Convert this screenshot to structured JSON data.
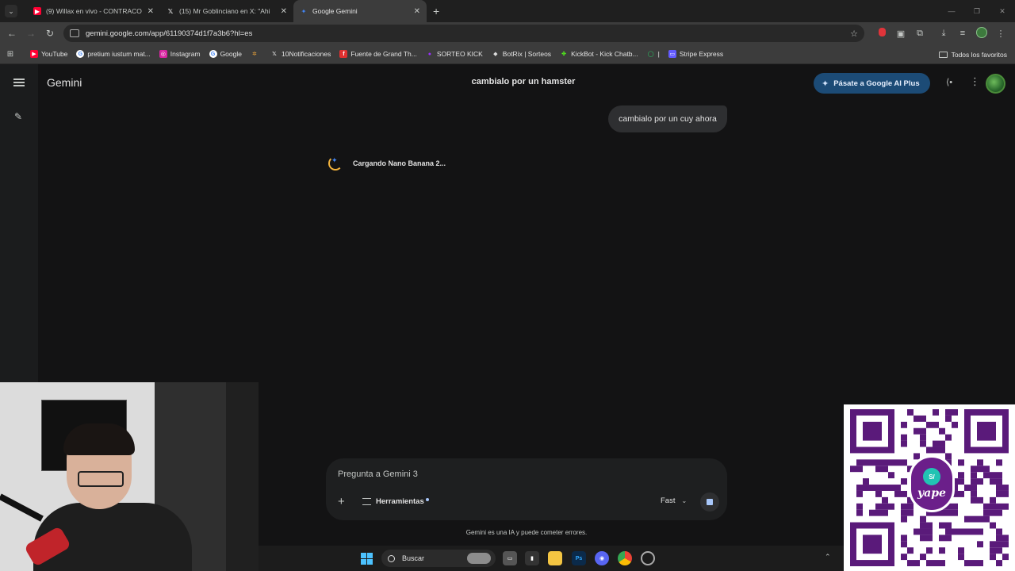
{
  "browser": {
    "tabs": [
      {
        "title": "(9) Willax en vivo - CONTRACO",
        "favicon": "youtube-icon",
        "color": "#ff0033",
        "active": false
      },
      {
        "title": "(15) Mr Goblinciano en X: \"Ahi",
        "favicon": "x-icon",
        "color": "#000000",
        "active": false
      },
      {
        "title": "Google Gemini",
        "favicon": "gemini-icon",
        "color": "#4285f4",
        "active": true
      }
    ],
    "url": "gemini.google.com/app/61190374d1f7a3b6?hl=es",
    "bookmarks": [
      {
        "label": "YouTube",
        "icon": "youtube-icon",
        "color": "#ff0033"
      },
      {
        "label": "pretium iustum mat...",
        "icon": "google-icon",
        "color": "#ffffff"
      },
      {
        "label": "Instagram",
        "icon": "instagram-icon",
        "color": "#d6249f"
      },
      {
        "label": "Google",
        "icon": "google-icon",
        "color": "#ffffff"
      },
      {
        "label": "",
        "icon": "pinwheel-icon",
        "color": "#e8a23b"
      },
      {
        "label": "10Notificaciones",
        "icon": "x-icon",
        "color": "#000000"
      },
      {
        "label": "Fuente de Grand Th...",
        "icon": "font-icon",
        "color": "#e03030"
      },
      {
        "label": "SORTEO KICK",
        "icon": "purple-dot-icon",
        "color": "#9b30ff"
      },
      {
        "label": "BotRix | Sorteos",
        "icon": "diamond-icon",
        "color": "#dddddd"
      },
      {
        "label": "KickBot - Kick Chatb...",
        "icon": "kickbot-icon",
        "color": "#53fc18"
      },
      {
        "label": "|",
        "icon": "whatsapp-icon",
        "color": "#25d366"
      },
      {
        "label": "Stripe Express",
        "icon": "stripe-icon",
        "color": "#635bff"
      }
    ],
    "all_bookmarks_label": "Todos los favoritos"
  },
  "gemini": {
    "brand": "Gemini",
    "conversation_title": "cambialo por un hamster",
    "upgrade_label": "Pásate a Google AI Plus",
    "user_message": "cambialo por un cuy ahora",
    "loading_text": "Cargando Nano Banana 2...",
    "input_placeholder": "Pregunta a Gemini 3",
    "tools_label": "Herramientas",
    "model_label": "Fast",
    "disclaimer": "Gemini es una IA y puede cometer errores.",
    "accent": "#1c4b76"
  },
  "overlays": {
    "qr_brand": "yape",
    "qr_symbol": "S/"
  },
  "taskbar": {
    "search_label": "Buscar",
    "apps": [
      "file-explorer-icon",
      "taskview-icon",
      "files-icon",
      "photoshop-icon",
      "discord-icon",
      "chrome-icon",
      "app-icon"
    ]
  }
}
